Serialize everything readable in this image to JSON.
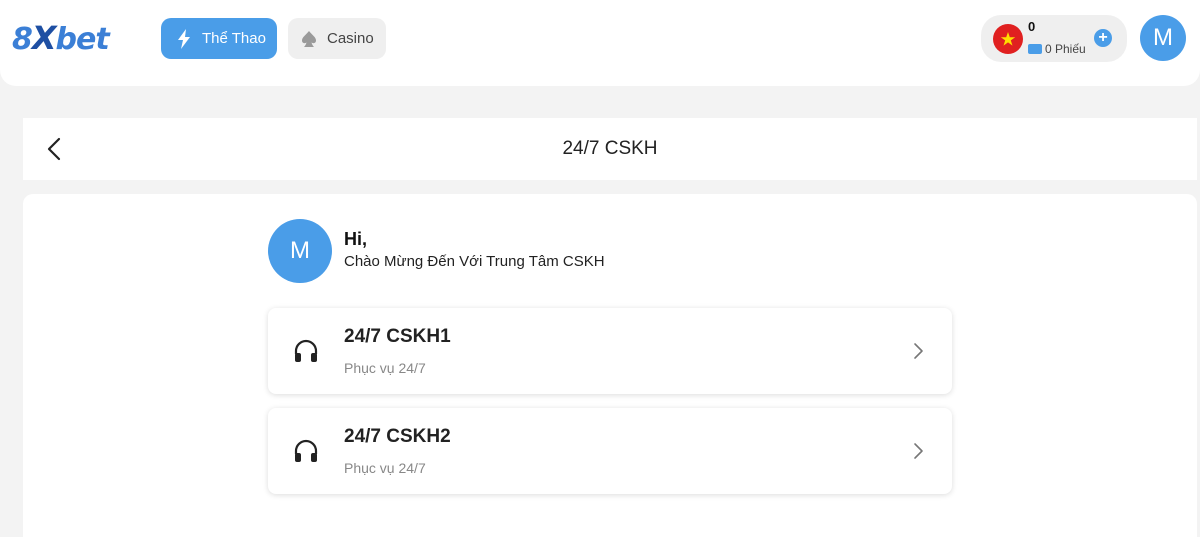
{
  "brand": {
    "logo_text_a": "8",
    "logo_text_x": "X",
    "logo_text_b": "bet"
  },
  "nav": {
    "sports_label": "Thể Thao",
    "casino_label": "Casino"
  },
  "wallet": {
    "balance": "0",
    "tickets": "0 Phiếu",
    "plus_label": "+"
  },
  "user": {
    "avatar_initial": "M"
  },
  "header": {
    "title": "24/7 CSKH"
  },
  "greeting": {
    "avatar_initial": "M",
    "hi": "Hi,",
    "subtitle": "Chào Mừng Đến Với Trung Tâm CSKH"
  },
  "support_options": [
    {
      "title": "24/7 CSKH1",
      "subtitle": "Phục vụ 24/7",
      "icon": "headphones-icon"
    },
    {
      "title": "24/7 CSKH2",
      "subtitle": "Phục vụ 24/7",
      "icon": "headphones-icon"
    }
  ],
  "colors": {
    "accent": "#4a9de8",
    "flag_red": "#e02020",
    "flag_star": "#ffde00"
  }
}
